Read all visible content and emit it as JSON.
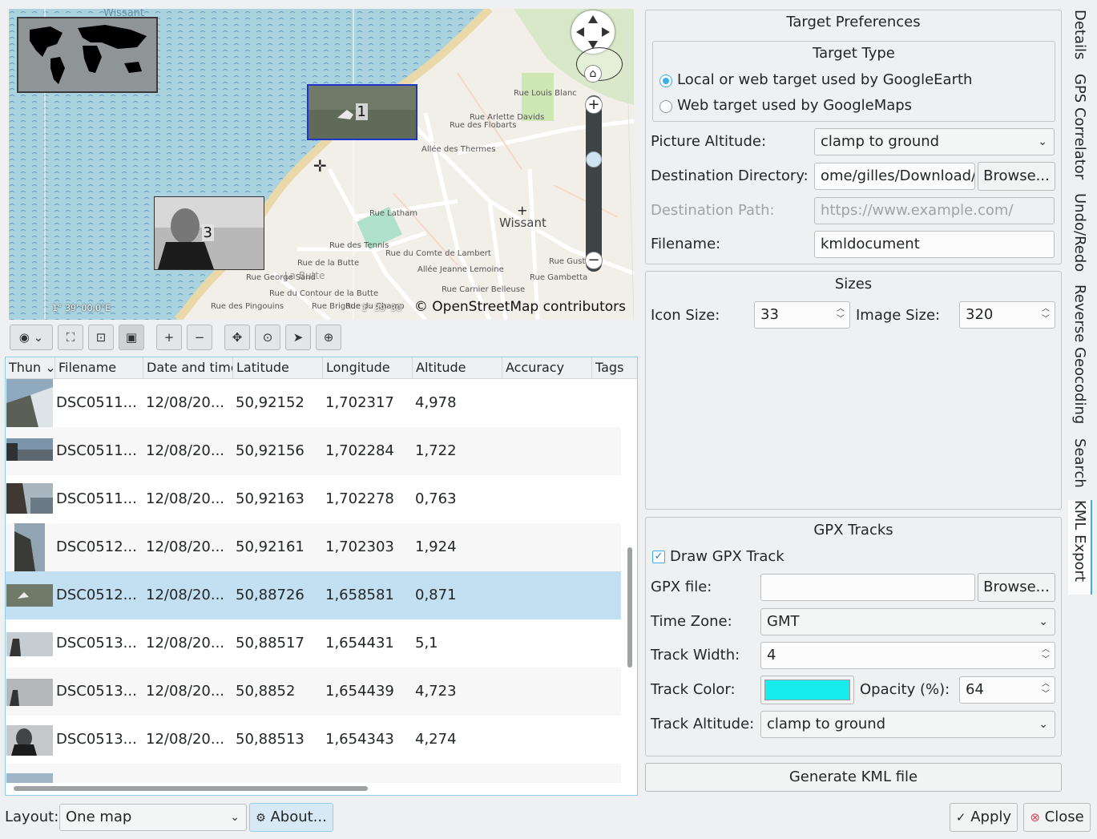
{
  "map": {
    "place_label": "Wissant",
    "top_label": "Wissant",
    "attribution": "© OpenStreetMap contributors",
    "coord_left": "1° 39' 00,0\"E",
    "coord_right": "1° 39' 30",
    "street_labels": [
      "Rue Louis Blanc",
      "Rue Arlette Davids",
      "Allée des Thermes",
      "Rue des Flobarts",
      "Rue Latham",
      "Rue des Tennis",
      "Rue du Comte de Lambert",
      "Allée Jeanne Lemoine",
      "Rue Carnier Belleuse",
      "Rue Gambetta",
      "La Butte",
      "Rue Gustave",
      "Rue de la Butte",
      "Rue du Contour de la Butte",
      "Rue George Sand",
      "Rue Brigode",
      "Rue des Pingouins",
      "Rue du Champ"
    ],
    "markers": [
      {
        "number": "1",
        "selected": true
      },
      {
        "number": "3",
        "selected": false
      }
    ],
    "zoom_in": "+",
    "zoom_out": "−"
  },
  "toolbar": {
    "buttons": [
      "globe-menu",
      "zoom-fit",
      "zoom-selection",
      "show-thumbnails",
      "zoom-in",
      "zoom-out",
      "pan-mode",
      "select-mode",
      "cursor",
      "filter"
    ]
  },
  "table": {
    "columns": [
      "Thun",
      "Filename",
      "Date and time",
      "Latitude",
      "Longitude",
      "Altitude",
      "Accuracy",
      "Tags"
    ],
    "rows": [
      {
        "filename": "DSC0511...",
        "date": "12/08/20...",
        "lat": "50,92152",
        "lon": "1,702317",
        "alt": "4,978"
      },
      {
        "filename": "DSC0511...",
        "date": "12/08/20...",
        "lat": "50,92156",
        "lon": "1,702284",
        "alt": "1,722"
      },
      {
        "filename": "DSC0511...",
        "date": "12/08/20...",
        "lat": "50,92163",
        "lon": "1,702278",
        "alt": "0,763"
      },
      {
        "filename": "DSC0512...",
        "date": "12/08/20...",
        "lat": "50,92161",
        "lon": "1,702303",
        "alt": "1,924"
      },
      {
        "filename": "DSC0512...",
        "date": "12/08/20...",
        "lat": "50,88726",
        "lon": "1,658581",
        "alt": "0,871"
      },
      {
        "filename": "DSC0513...",
        "date": "12/08/20...",
        "lat": "50,88517",
        "lon": "1,654431",
        "alt": "5,1"
      },
      {
        "filename": "DSC0513...",
        "date": "12/08/20...",
        "lat": "50,8852",
        "lon": "1,654439",
        "alt": "4,723"
      },
      {
        "filename": "DSC0513...",
        "date": "12/08/20...",
        "lat": "50,88513",
        "lon": "1,654343",
        "alt": "4,274"
      }
    ],
    "selected_row": 4
  },
  "bottom": {
    "layout_label": "Layout:",
    "layout_value": "One map",
    "about_label": "About...",
    "apply_label": "Apply",
    "close_label": "Close"
  },
  "target": {
    "group_title": "Target Preferences",
    "type_title": "Target Type",
    "radio_local": "Local or web target used by GoogleEarth",
    "radio_web": "Web target used by GoogleMaps",
    "altitude_label": "Picture Altitude:",
    "altitude_value": "clamp to ground",
    "dest_dir_label": "Destination Directory:",
    "dest_dir_value": "ome/gilles/Download/",
    "browse_label": "Browse...",
    "dest_path_label": "Destination Path:",
    "dest_path_placeholder": "https://www.example.com/",
    "filename_label": "Filename:",
    "filename_value": "kmldocument"
  },
  "sizes": {
    "title": "Sizes",
    "icon_label": "Icon Size:",
    "icon_value": "33",
    "image_label": "Image Size:",
    "image_value": "320"
  },
  "gpx": {
    "title": "GPX Tracks",
    "draw_label": "Draw GPX Track",
    "file_label": "GPX file:",
    "browse_label": "Browse...",
    "tz_label": "Time Zone:",
    "tz_value": "GMT",
    "width_label": "Track Width:",
    "width_value": "4",
    "color_label": "Track Color:",
    "color_value": "#17ebeb",
    "opacity_label": "Opacity (%):",
    "opacity_value": "64",
    "alt_label": "Track Altitude:",
    "alt_value": "clamp to ground"
  },
  "generate_label": "Generate KML file",
  "side_tabs": [
    "Details",
    "GPS Correlator",
    "Undo/Redo",
    "Reverse Geocoding",
    "Search",
    "KML Export"
  ],
  "colors": {
    "accent": "#3daee9",
    "selection": "#c3e0f2",
    "water": "#aad3df"
  }
}
